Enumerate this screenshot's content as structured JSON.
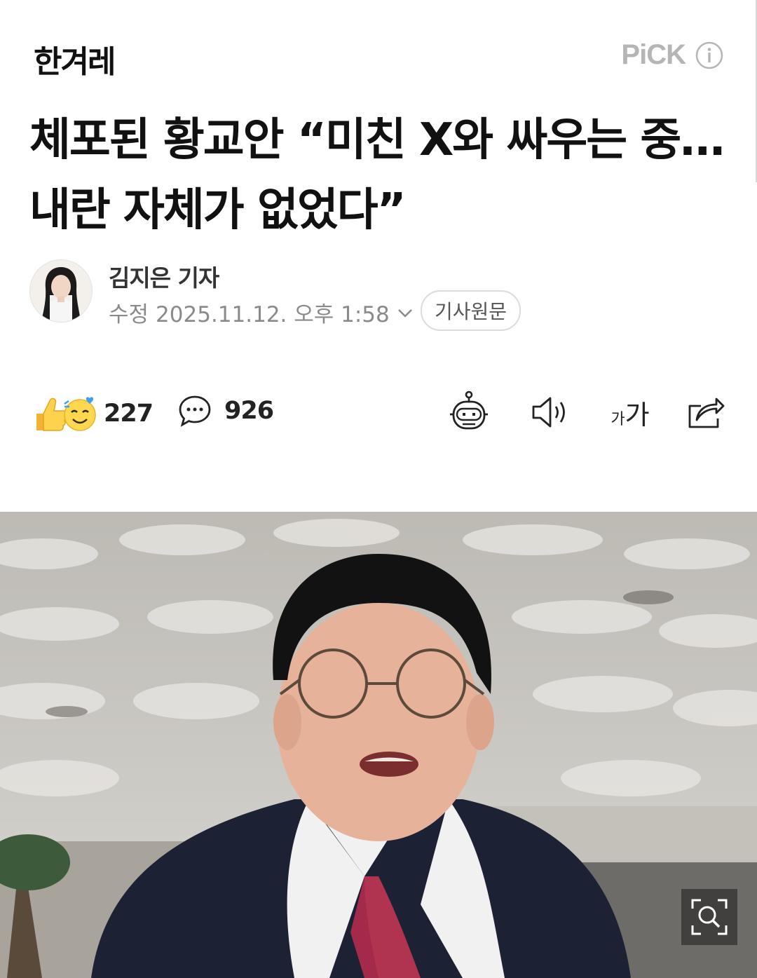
{
  "header": {
    "press_logo": "한겨레",
    "pick_label": "PiCK"
  },
  "article": {
    "headline": "체포된 황교안 “미친 X와 싸우는 중…내란 자체가 없었다”",
    "reporter": "김지은 기자",
    "date_prefix": "수정",
    "date": "2025.11.12. 오후 1:58",
    "original_button": "기사원문"
  },
  "actions": {
    "reaction_count": "227",
    "comment_count": "926"
  },
  "icons": [
    "info-icon",
    "chevron-down-icon",
    "reaction-emoji-icon",
    "comment-icon",
    "ai-summary-bot-icon",
    "speaker-icon",
    "font-size-icon",
    "share-icon",
    "zoom-icon"
  ],
  "colors": {
    "text": "#111111",
    "muted": "#8a8a8a",
    "pick": "#b5b5b5"
  }
}
